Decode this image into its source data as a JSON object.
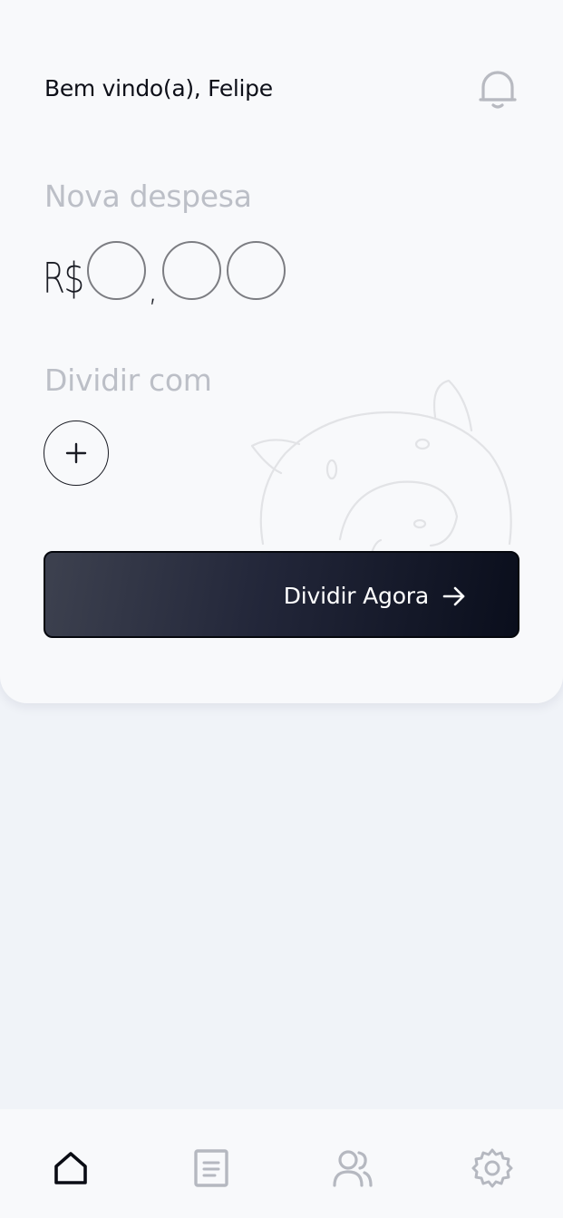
{
  "header": {
    "greeting": "Bem vindo(a), Felipe",
    "notification_icon": "bell-icon"
  },
  "expense": {
    "label": "Nova despesa",
    "currency": "R$",
    "separator": ",",
    "digits": [
      "",
      "",
      ""
    ]
  },
  "split": {
    "label": "Dividir com",
    "add_icon": "plus-icon"
  },
  "cta": {
    "label": "Dividir Agora",
    "icon": "arrow-right-icon"
  },
  "nav": {
    "items": [
      {
        "icon": "home-icon",
        "active": true
      },
      {
        "icon": "document-list-icon",
        "active": false
      },
      {
        "icon": "users-icon",
        "active": false
      },
      {
        "icon": "settings-gear-icon",
        "active": false
      }
    ]
  },
  "colors": {
    "page_background": "#f0f3f8",
    "card_background": "#f8f9fb",
    "muted_text": "#bcbfc7",
    "primary_dark": "#0a0e1c",
    "nav_inactive": "#b5b8c0"
  }
}
